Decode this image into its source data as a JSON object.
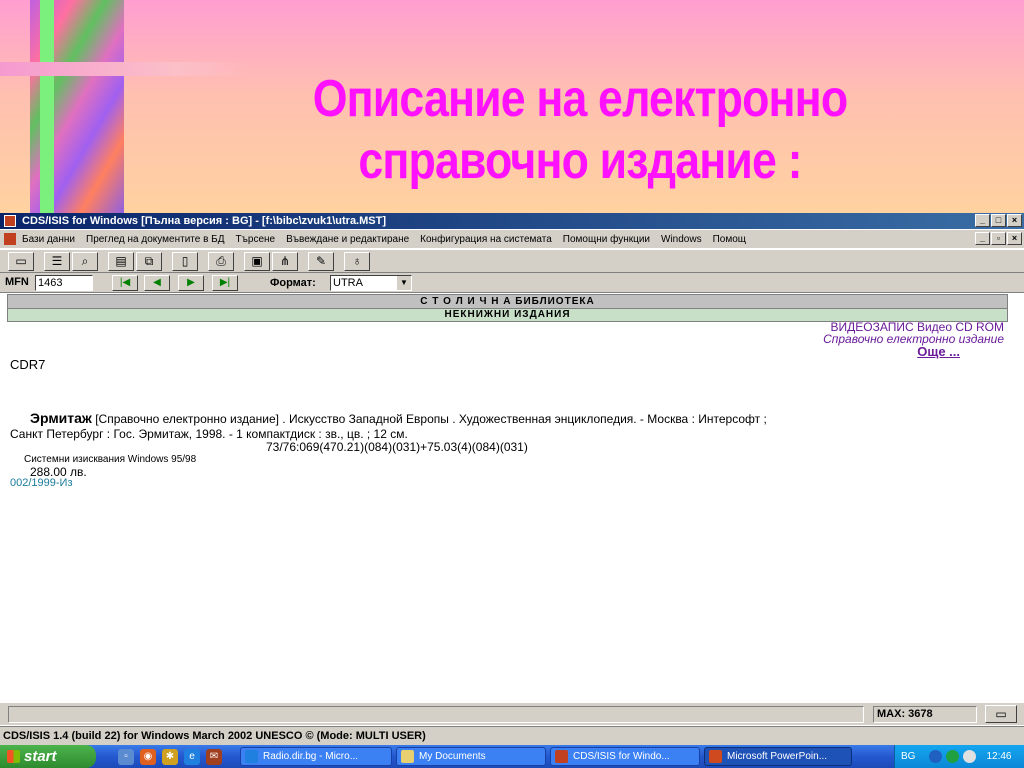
{
  "slide": {
    "title_line1": "Описание на електронно",
    "title_line2": "справочно издание :"
  },
  "window": {
    "title": "CDS/ISIS for Windows [Пълна версия : BG] - [f:\\bibc\\zvuk1\\utra.MST]",
    "controls": [
      "_",
      "□",
      "×"
    ],
    "child_controls": [
      "_",
      "▫",
      "×"
    ]
  },
  "menu": {
    "items": [
      "Бази данни",
      "Преглед на документите в БД",
      "Търсене",
      "Въвеждане и редактиране",
      "Конфигурация на системата",
      "Помощни функции",
      "Windows",
      "Помощ"
    ]
  },
  "toolbar": {
    "icons": [
      "open-folder-icon",
      "list-icon",
      "search-db-icon",
      "clipboard-icon",
      "copy-records-icon",
      "document-search-icon",
      "print-icon",
      "save-icon",
      "hierarchy-icon",
      "edit-pencil-icon",
      "lamp-icon"
    ]
  },
  "nav": {
    "mfn_label": "MFN",
    "mfn_value": "1463",
    "format_label": "Формат:",
    "format_value": "UTRA"
  },
  "record": {
    "header1": "С Т О Л И Ч Н А  БИБЛИОТЕКА",
    "header2": "НЕКНИЖНИ  ИЗДАНИЯ",
    "media_type": "ВИДЕОЗАПИС Видео CD ROM",
    "subtype": "Справочно електронно издание",
    "more_link": "Още ...",
    "code": "CDR7",
    "main_title": "Эрмитаж",
    "description": " [Справочно електронно издание] . Искусство Западной Европы . Художественная энциклопедия. - Москва : Интерсофт ;",
    "imprint": "Санкт Петербург : Гос. Эрмитаж, 1998. - 1 компактдиск : зв., цв. ; 12 см.",
    "classification": "73/76:069(470.21)(084)(031)+75.03(4)(084)(031)",
    "requirements": "Системни изисквания Windows 95/98",
    "price": "288.00 лв.",
    "inventory": "002/1999-Из"
  },
  "status": {
    "max_label": "MAX: 3678",
    "app_status": "CDS/ISIS 1.4 (build 22) for Windows   March 2002   UNESCO ©  (Mode: MULTI USER)"
  },
  "taskbar": {
    "start": "start",
    "tasks": [
      "Radio.dir.bg - Micro...",
      "My Documents",
      "CDS/ISIS for Windo...",
      "Microsoft PowerPoin..."
    ],
    "lang": "BG",
    "time": "12:46"
  }
}
